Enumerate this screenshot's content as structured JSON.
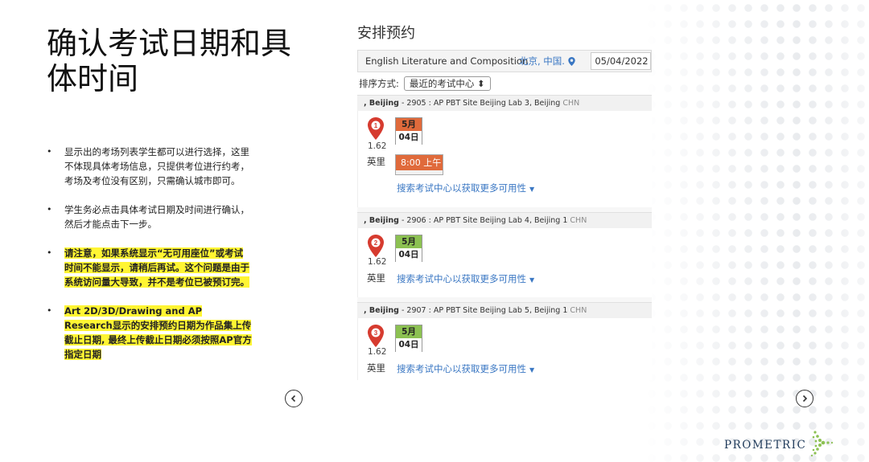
{
  "slide": {
    "title": "确认考试日期和具体时间",
    "bullets": [
      {
        "text": "显示出的考场列表学生都可以进行选择，这里不体现具体考场信息，只提供考位进行约考，考场及考位没有区别，只需确认城市即可。",
        "highlight": false
      },
      {
        "text": "学生务必点击具体考试日期及时间进行确认，然后才能点击下一步。",
        "highlight": false
      },
      {
        "text": "请注意，如果系统显示“无可用座位”或考试时间不能显示，请稍后再试。这个问题是由于系统访问量大导致，并不是考位已被预订完。",
        "highlight": true
      },
      {
        "text": "Art 2D/3D/Drawing and AP Research显示的安排预约日期为作品集上传截止日期, 最终上传截止日期必须按照AP官方指定日期",
        "highlight": true
      }
    ]
  },
  "panel": {
    "title": "安排预约",
    "search": {
      "exam_name": "English Literature and Composition",
      "location": "北京, 中国.",
      "date": "05/04/2022 -"
    },
    "sort": {
      "label": "排序方式:",
      "selected": "最近的考试中心 ⬍"
    },
    "sites": [
      {
        "prefix": ", Beijing",
        "detail": " - 2905 : AP PBT Site Beijing Lab 3, Beijing ",
        "country": "CHN",
        "marker_number": "1",
        "distance": "1.62",
        "unit": "英里",
        "month": "5月",
        "day": "04日",
        "badge_color": "#e06a3b",
        "time": "8:00 上午",
        "more_link": "搜索考试中心以获取更多可用性"
      },
      {
        "prefix": ", Beijing",
        "detail": " - 2906 : AP PBT Site Beijing Lab 4, Beijing 1 ",
        "country": "CHN",
        "marker_number": "2",
        "distance": "1.62",
        "unit": "英里",
        "month": "5月",
        "day": "04日",
        "badge_color": "#8cc152",
        "more_link": "搜索考试中心以获取更多可用性"
      },
      {
        "prefix": ", Beijing",
        "detail": " - 2907 : AP PBT Site Beijing Lab 5, Beijing 1 ",
        "country": "CHN",
        "marker_number": "3",
        "distance": "1.62",
        "unit": "英里",
        "month": "5月",
        "day": "04日",
        "badge_color": "#8cc152",
        "more_link": "搜索考试中心以获取更多可用性"
      }
    ]
  },
  "nav": {
    "prev_icon": "chevron-left-icon",
    "next_icon": "chevron-right-icon"
  },
  "brand": {
    "logo_text": "PROMETRIC",
    "color": "#1f3a5a"
  },
  "colors": {
    "marker": "#d63b2f",
    "link": "#3a77c3",
    "highlight": "#fff533"
  }
}
